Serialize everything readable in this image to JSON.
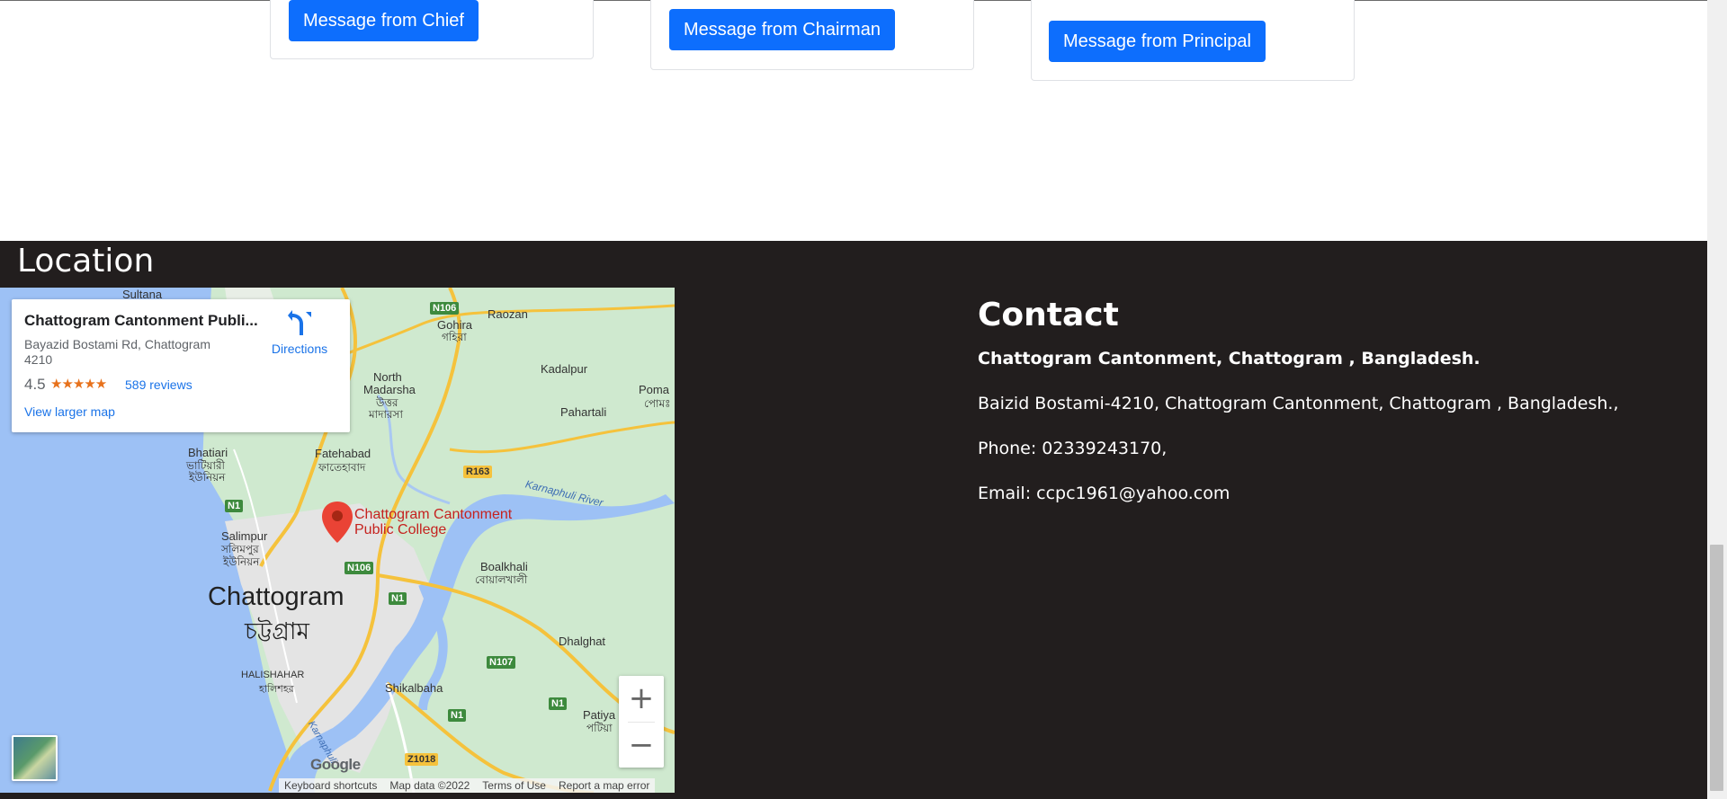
{
  "messages": {
    "chief_label": "Message from Chief",
    "chairman_label": "Message from Chairman",
    "principal_label": "Message from Principal"
  },
  "location": {
    "title": "Location"
  },
  "map": {
    "place_name": "Chattogram Cantonment Publi...",
    "address_line": "Bayazid Bostami Rd, Chattogram 4210",
    "rating": "4.5",
    "stars": "★★★★★",
    "reviews": "589 reviews",
    "larger_map": "View larger map",
    "directions": "Directions",
    "zoom_in": "+",
    "zoom_out": "−",
    "google_logo": "Google",
    "marker_label_1": "Chattogram Cantonment",
    "marker_label_2": "Public College",
    "labels": {
      "sultana": "Sultana",
      "gohira": "Gohira",
      "gohira_bn": "গহিরা",
      "raozan": "Raozan",
      "kadalpur": "Kadalpur",
      "poma": "Poma",
      "poma_bn": "পোমঃ",
      "north_madarsha": "North",
      "north_madarsha_2": "Madarsha",
      "north_madarsha_bn": "উত্তর",
      "north_madarsha_bn2": "মাদারসা",
      "pahartali": "Pahartali",
      "bhatiari": "Bhatiari",
      "bhatiari_bn": "ভাটিয়ারী",
      "bhatiari_bn2": "ইউনিয়ন",
      "fatehabad": "Fatehabad",
      "fatehabad_bn": "ফাতেহাবাদ",
      "karnaphuli": "Karnaphuli River",
      "salimpur": "Salimpur",
      "salimpur_bn": "সলিমপুর",
      "salimpur_bn2": "ইউনিয়ন",
      "boalkhali": "Boalkhali",
      "boalkhali_bn": "বোয়ালখালী",
      "chattogram": "Chattogram",
      "chattogram_bn": "চট্টগ্রাম",
      "dhalghat": "Dhalghat",
      "halishahar": "HALISHAHAR",
      "halishahar_bn": "হালিশহর",
      "shikalbaha": "Shikalbaha",
      "patiya": "Patiya",
      "patiya_bn": "পটিয়া",
      "karnaphuli_small": "Karnaphuli"
    },
    "shields": {
      "n106_top": "N106",
      "r163": "R163",
      "n1_left": "N1",
      "n106_mid": "N106",
      "n1_mid": "N1",
      "n107": "N107",
      "n1_right": "N1",
      "n1_bottom": "N1",
      "z1018": "Z1018"
    },
    "attribution": {
      "shortcuts": "Keyboard shortcuts",
      "map_data": "Map data ©2022",
      "terms": "Terms of Use",
      "report": "Report a map error"
    }
  },
  "contact": {
    "title": "Contact",
    "org": "Chattogram Cantonment, Chattogram , Bangladesh.",
    "address": "Baizid Bostami-4210, Chattogram Cantonment, Chattogram , Bangladesh.,",
    "phone": "Phone: 02339243170,",
    "email": "Email: ccpc1961@yahoo.com"
  },
  "colors": {
    "button_blue": "#0d6efd",
    "footer_bg": "#221e1e",
    "map_link_blue": "#1a73e8",
    "marker_red": "#ea4335",
    "star_orange": "#e7711b"
  }
}
